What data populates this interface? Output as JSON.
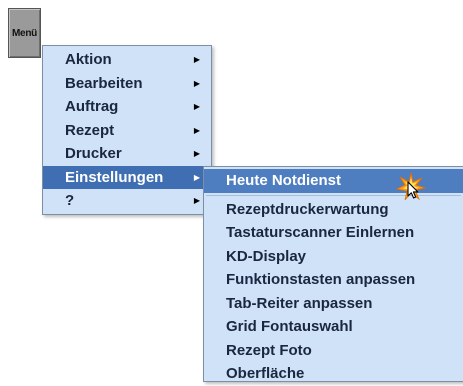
{
  "menu_button": {
    "label": "Menü"
  },
  "main_menu": {
    "items": [
      {
        "label": "Aktion",
        "submenu_indicator": "▶"
      },
      {
        "label": "Bearbeiten",
        "submenu_indicator": "▶"
      },
      {
        "label": "Auftrag",
        "submenu_indicator": "▶"
      },
      {
        "label": "Rezept",
        "submenu_indicator": "▶"
      },
      {
        "label": "Drucker",
        "submenu_indicator": "▶"
      },
      {
        "label": "Einstellungen",
        "submenu_indicator": "▶"
      },
      {
        "label": "?",
        "submenu_indicator": "▶"
      }
    ]
  },
  "settings_submenu": {
    "items": [
      {
        "label": "Heute Notdienst"
      },
      {
        "label": "Rezeptdruckerwartung"
      },
      {
        "label": "Tastaturscanner Einlernen"
      },
      {
        "label": "KD-Display"
      },
      {
        "label": "Funktionstasten anpassen"
      },
      {
        "label": "Tab-Reiter anpassen"
      },
      {
        "label": "Grid Fontauswahl"
      },
      {
        "label": "Rezept Foto"
      },
      {
        "label": "Oberfläche"
      }
    ]
  },
  "colors": {
    "menu_background": "#cfe2f7",
    "highlight": "#3f6fb2",
    "text": "#1b2740"
  }
}
